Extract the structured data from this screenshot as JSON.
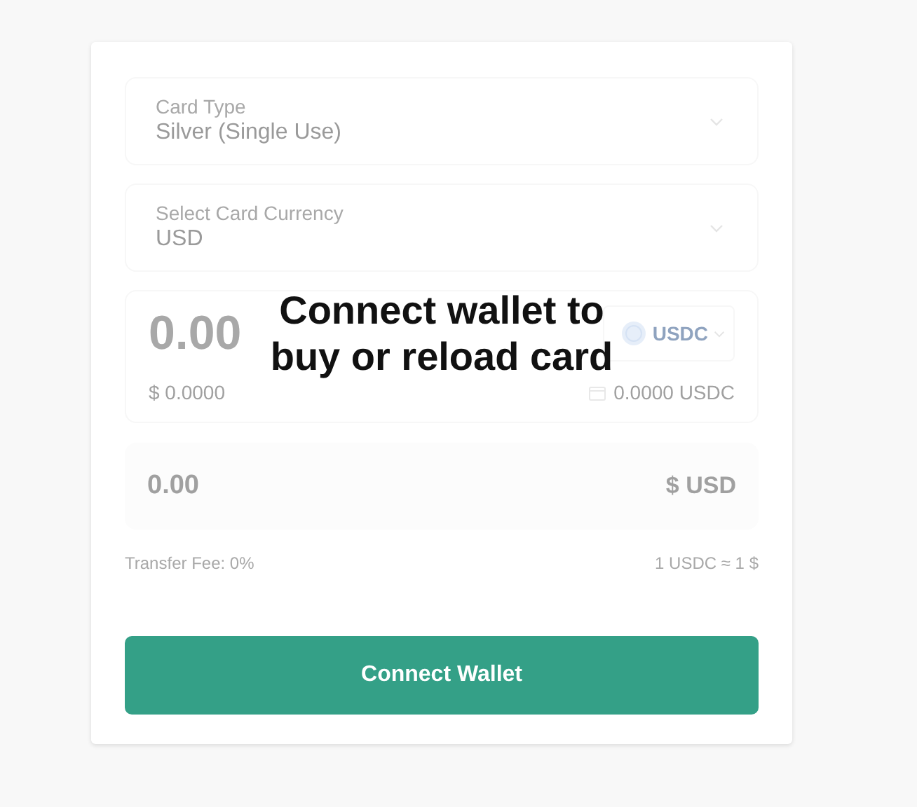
{
  "card_type": {
    "label": "Card Type",
    "value": "Silver (Single Use)"
  },
  "currency": {
    "label": "Select Card Currency",
    "value": "USD"
  },
  "pay": {
    "amount": "0.00",
    "token": "USDC",
    "usd_value": "$ 0.0000",
    "balance": "0.0000 USDC"
  },
  "receive": {
    "amount": "0.00",
    "unit": "$ USD"
  },
  "transfer_fee": "Transfer Fee: 0%",
  "rate": "1 USDC ≈ 1 $",
  "overlay": {
    "message": "Connect wallet to buy or reload card"
  },
  "connect_button": "Connect Wallet"
}
